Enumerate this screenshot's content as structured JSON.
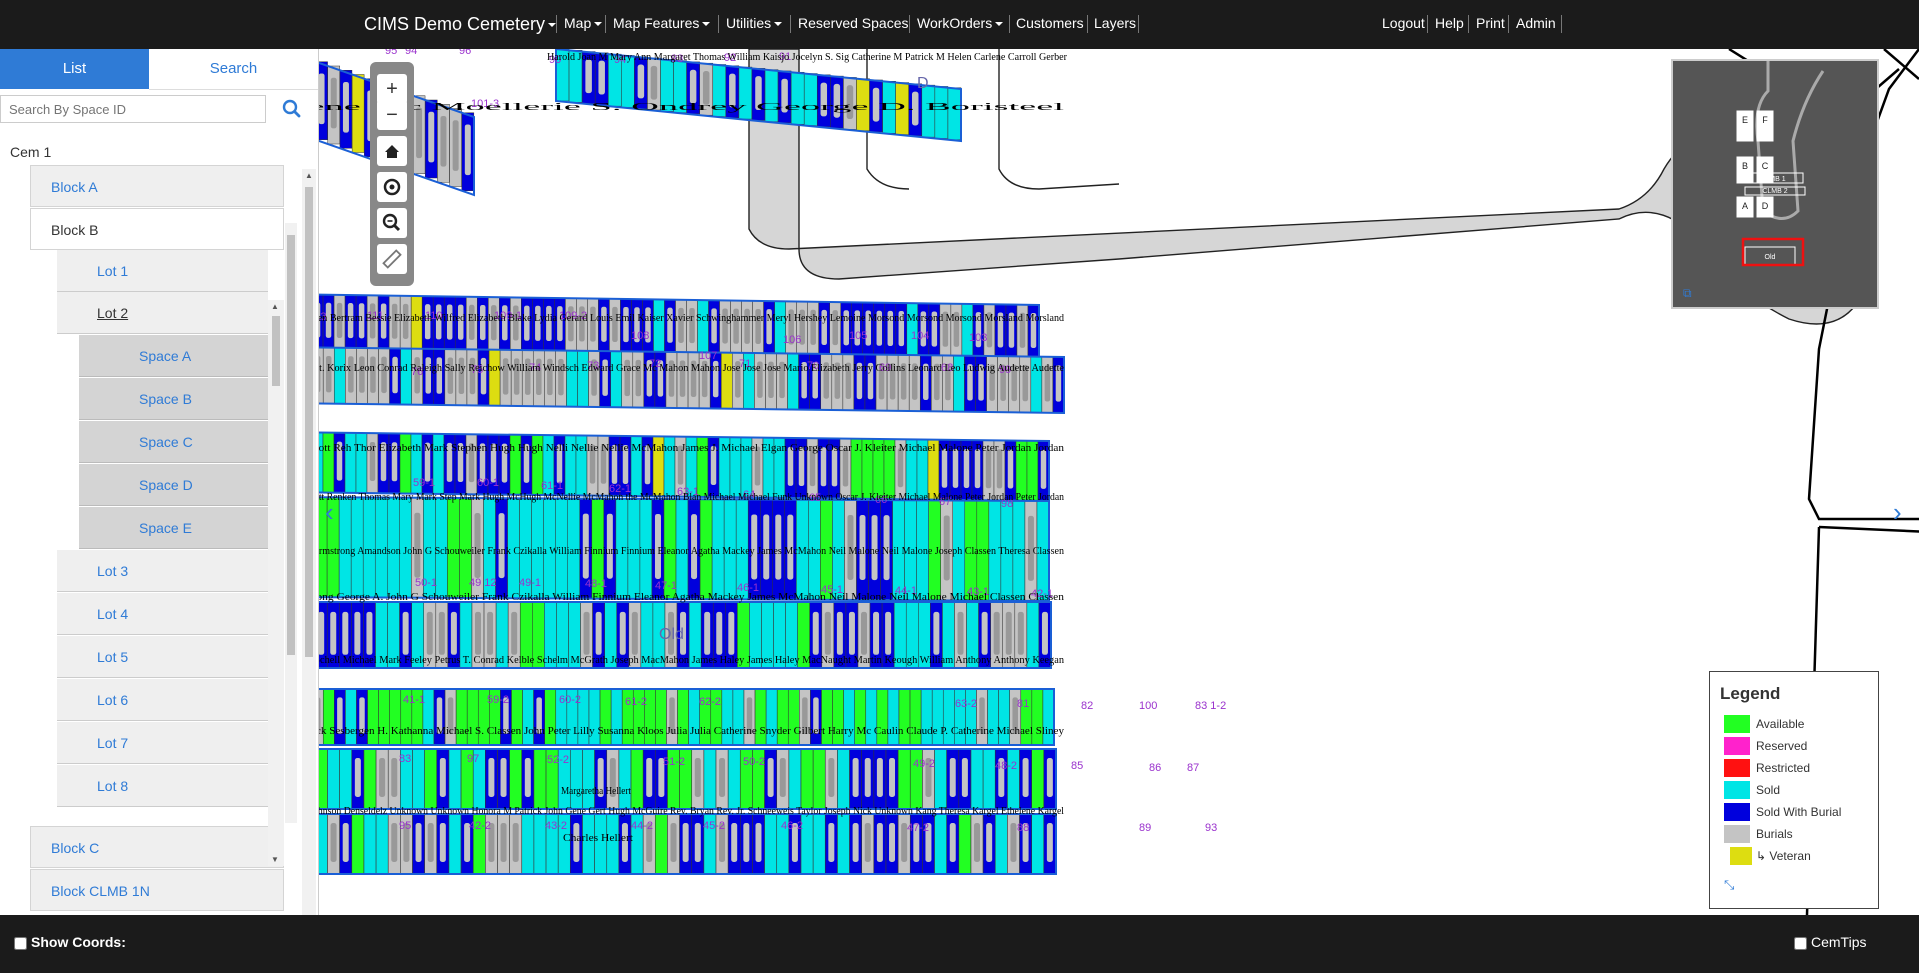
{
  "app": {
    "title": "CIMS Demo Cemetery"
  },
  "nav": {
    "map": "Map",
    "map_features": "Map Features",
    "utilities": "Utilities",
    "reserved_spaces": "Reserved Spaces",
    "workorders": "WorkOrders",
    "customers": "Customers",
    "layers": "Layers",
    "logout": "Logout",
    "help": "Help",
    "print": "Print",
    "admin": "Admin"
  },
  "sidebar": {
    "tabs": [
      "List",
      "Search"
    ],
    "search_placeholder": "Search By Space ID",
    "tree": {
      "cemetery": "Cem 1",
      "blocks": [
        "Block A",
        "Block B",
        "Block C",
        "Block CLMB 1N"
      ],
      "lots": [
        "Lot 1",
        "Lot 2",
        "Lot 3",
        "Lot 4",
        "Lot 5",
        "Lot 6",
        "Lot 7",
        "Lot 8"
      ],
      "spaces": [
        "Space A",
        "Space B",
        "Space C",
        "Space D",
        "Space E"
      ]
    }
  },
  "map": {
    "section_labels": [
      "D",
      "Old"
    ],
    "row_numbers": [
      "95",
      "96",
      "101",
      "101-3",
      "94",
      "93",
      "92",
      "91",
      "90",
      "113",
      "111",
      "110",
      "109-1",
      "109-2",
      "108",
      "107",
      "106",
      "105",
      "104",
      "103",
      "76",
      "75",
      "74",
      "73",
      "72",
      "71",
      "70",
      "69",
      "68",
      "99",
      "59-1",
      "60-1",
      "61-1",
      "62-1",
      "63-1",
      "64",
      "65",
      "66",
      "67",
      "98",
      "50-1",
      "49 12",
      "49-1",
      "48-1",
      "47-1",
      "46-1",
      "45-1",
      "44-1",
      "43-1",
      "42-1",
      "41-1",
      "59-2",
      "60-2",
      "61-2",
      "62-2",
      "63-2",
      "81",
      "82",
      "100",
      "83 1-2",
      "83",
      "97",
      "52-2",
      "51-2",
      "50-2",
      "49-2",
      "48-2",
      "85",
      "86",
      "87",
      "95",
      "42-2",
      "43-2",
      "44-2",
      "45-2",
      "46-2",
      "47-2",
      "88",
      "89",
      "93",
      "94"
    ],
    "name_labels": [
      "Harold Joan M Mary Ann Margaret Thomas William Kaisjo Jocelyn S. Sig Catherine M Patrick M Helen Carlene Carroll Gerber",
      "Ilene Mc Moellerie S. Ondrey George D. Boristeel",
      "F. Sandsen Bertram Bessie Elizabeth Wilfred Elizabeth Blake Lydia Gerard Louis Emil Kaiser Xavier Schwinghammer Meryl Hershey Lemoine Morsond Morsond Morsond Morsland Morsland",
      "Frigan Ft. Korix Leon Conrad Raleigh Sally Reichow William Windsch Edward Grace Mc Mahon Mahon Jose Jose Jose Mario Elizabeth Jerry Collins Leonard Leo Ludwig Audette Audette",
      "Ernst Gott Reh Thor Elizabeth Mark Stephen Hugh Hugh Nelli Nellie Nellie McMahon James J. Michael Elgan George Oscar J. Kleiter Michael Malone Peter Jordan Jordan",
      "Ernst Gott Renken Thomas Mary Mark Step Mark Hugh McHugh McNellie McMahon the McMahon Blan Michael Michael Funk Unknown Oscar J. Kleiter Michael Malone Peter Jordan Peter Jordan",
      "Agnes Armstrong Amandson John G Schouweiler Frank Czikalla William Finnium Finnium Eleanor Agatha Mackey James McMahon Neil Malone Neil Malone Joseph Classen Theresa Classen",
      "Armstrong George A. John G Schouweiler Frank Czikalla William Finnium Eleanor Agatha Mackey James McMahon Neil Malone Neil Malone Michael Classen Classen",
      "Emilie Schell Michael Mark Feeley Petrus T. Conrad Kelble Schelm McGrath Joseph MacMahon James Haley James Haley MacNaught Martin Keough William Anthony Anthony Keegan",
      "Frederick Sesbergen H. Kathanna Michael S. Classen John Peter Lilly Susanna Kloos Julia Julia Catherine Snyder Gilbert Harry Mc Caulin Claude P. Catherine Michael Sliney",
      "Margaretha Hellert",
      "Frank Johnson Denseldelz Unknown Unknown Honora M Patrick John Gene Gert Hugh McGuire Rev. Bryan Rev. Jr. Schneeweis Taylor Joseph Nick Unknown Kang Theresa Kargel Ethelene Kargel",
      "Charles Hellert"
    ],
    "minimap_labels": [
      "E",
      "F",
      "B",
      "C",
      "A",
      "D",
      "CLMB 1",
      "CLMB 2",
      "Old"
    ]
  },
  "legend": {
    "title": "Legend",
    "items": [
      {
        "label": "Available",
        "color": "#22ff22"
      },
      {
        "label": "Reserved",
        "color": "#ff22cc"
      },
      {
        "label": "Restricted",
        "color": "#ff1111"
      },
      {
        "label": "Sold",
        "color": "#00e5e5"
      },
      {
        "label": "Sold With Burial",
        "color": "#0000dd"
      },
      {
        "label": "Burials",
        "color": "#c4c4c4"
      },
      {
        "label": "↳ Veteran",
        "color": "#dddd11"
      }
    ]
  },
  "footer": {
    "show_coords": "Show Coords:",
    "cemtips": "CemTips"
  },
  "colors": {
    "navbar": "#1b1b1b",
    "accent": "#2f7bd6",
    "plot_border": "#1a5fd6",
    "road": "#d6d6d6",
    "label_number": "#9a32cd"
  }
}
